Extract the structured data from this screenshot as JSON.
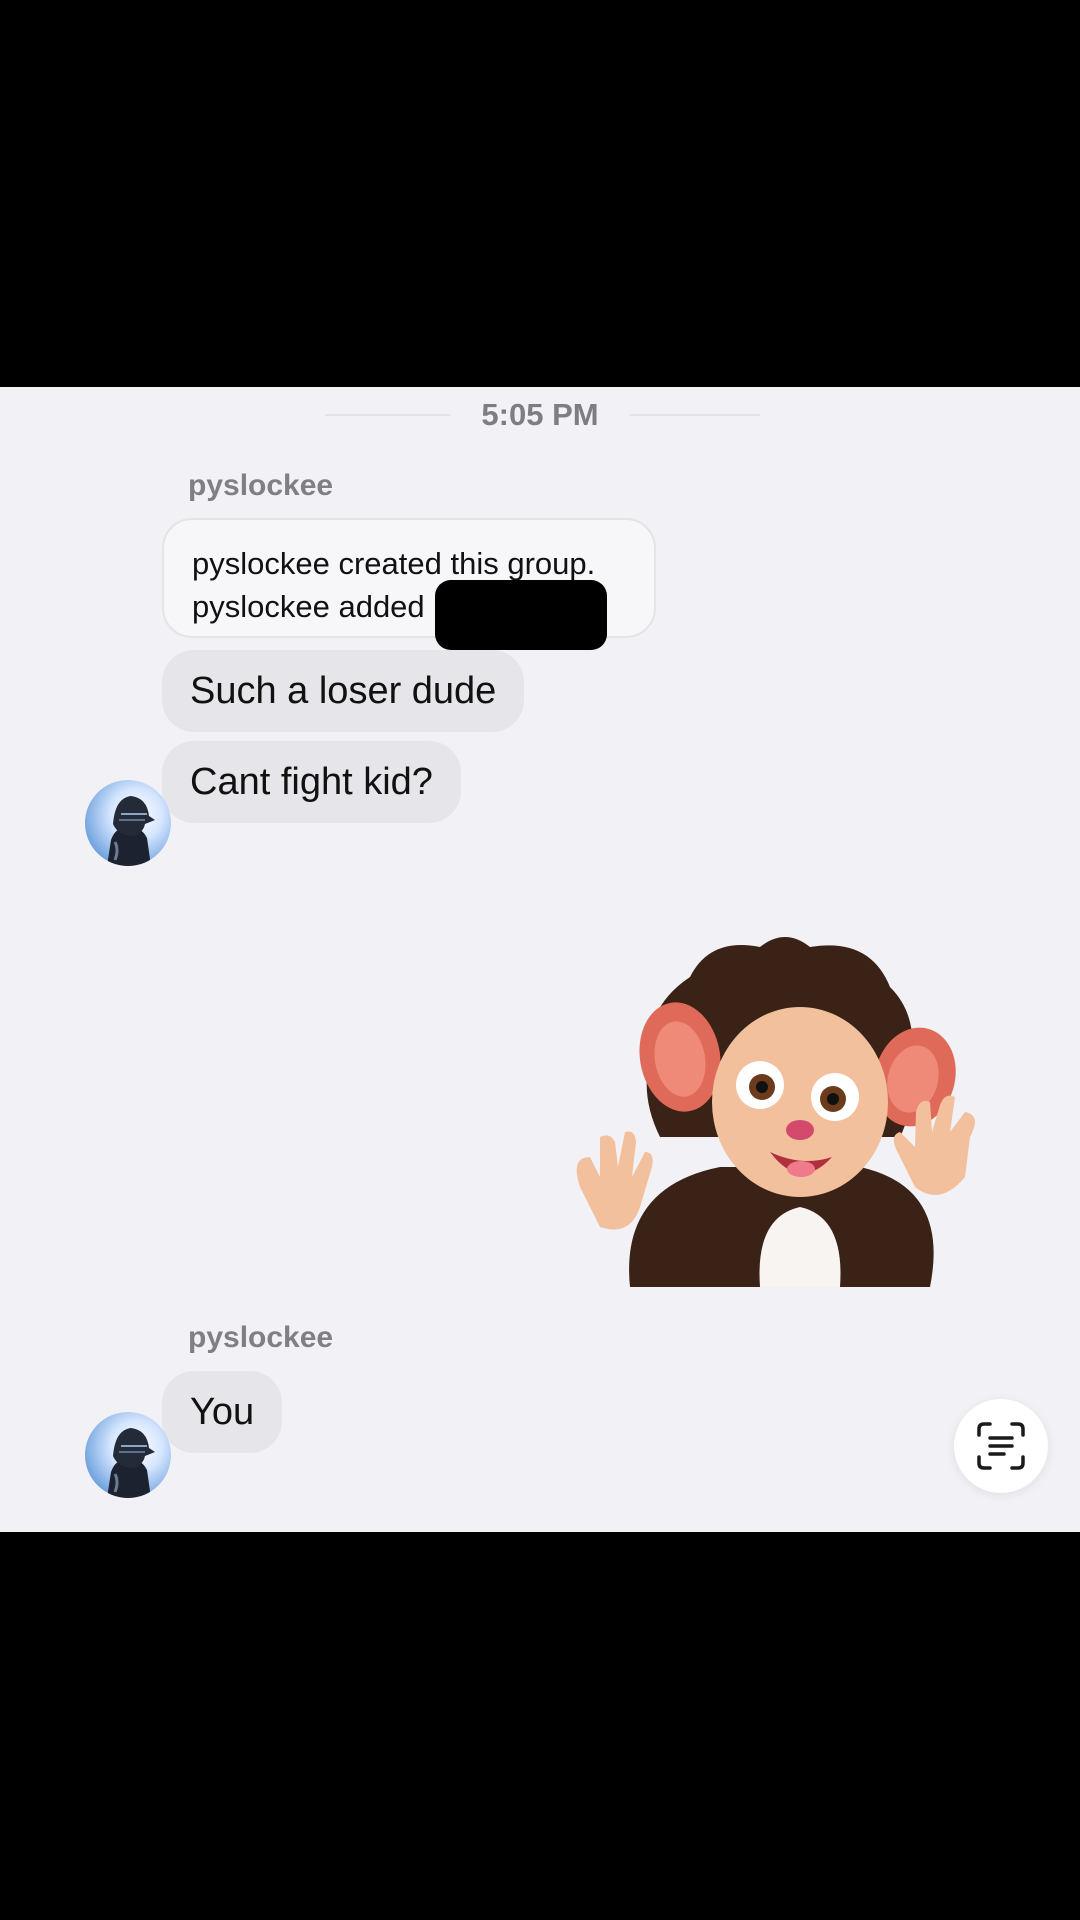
{
  "chat": {
    "time_divider": "5:05 PM",
    "groups": [
      {
        "sender": "pyslockee",
        "system_lines": [
          "pyslockee created this group.",
          "pyslockee added"
        ],
        "messages": [
          "Such a loser dude",
          "Cant fight kid?"
        ]
      },
      {
        "sender": "pyslockee",
        "messages": [
          "You"
        ]
      }
    ],
    "sticker_icon": "monkey-sticker-icon",
    "fab_icon": "scan-text-icon"
  }
}
